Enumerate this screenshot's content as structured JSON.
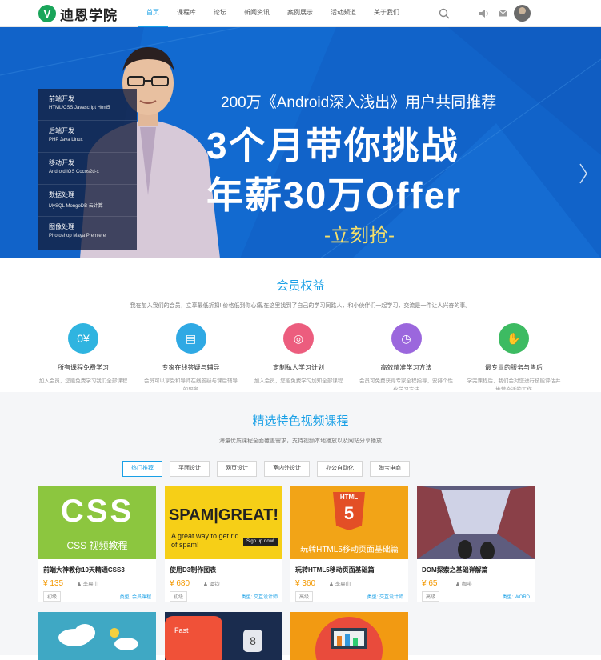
{
  "header": {
    "logo_text": "迪恩学院",
    "logo_glyph": "V",
    "nav": [
      "首页",
      "课程库",
      "论坛",
      "新闻资讯",
      "案例展示",
      "活动频道",
      "关于我们"
    ],
    "icons": [
      "search-icon",
      "volume-icon",
      "mail-icon",
      "avatar"
    ]
  },
  "banner": {
    "subtitle": "200万《Android深入浅出》用户共同推荐",
    "headline1": "3个月带你挑战",
    "headline2": "年薪30万Offer",
    "cta": "-立刻抢-",
    "menu": [
      {
        "title": "前端开发",
        "sub": "HTML/CSS    Javascript    Html5"
      },
      {
        "title": "后端开发",
        "sub": "PHP    Java    Linux"
      },
      {
        "title": "移动开发",
        "sub": "Android    iOS    Cocos2d-x"
      },
      {
        "title": "数据处理",
        "sub": "MySQL    MongoDB    云计算"
      },
      {
        "title": "图像处理",
        "sub": "Photoshop    Maya    Premiere"
      }
    ]
  },
  "benefits": {
    "title": "会员权益",
    "desc": "我在加入我们的会员，立享最低折扣! 价格低到你心痛,在这里找到了自己的学习同路人，和小伙伴们一起学习，交流是一件让人兴奋的事。",
    "items": [
      {
        "title": "所有课程免费学习",
        "desc": "加入会员，您能免费学习我们全部课程",
        "color": "#2fb4e0",
        "glyph": "0¥"
      },
      {
        "title": "专家在线答疑与辅导",
        "desc": "会员可以享受和导师在线答疑与课后辅导的服务",
        "color": "#2fa9e4",
        "glyph": "▤"
      },
      {
        "title": "定制私人学习计划",
        "desc": "加入会员，您能免费学习加知全部课程",
        "color": "#ec5d7e",
        "glyph": "◎"
      },
      {
        "title": "高效精准学习方法",
        "desc": "会员可免费获得专家全程指导，安排个性化学习方法",
        "color": "#9b67dd",
        "glyph": "◷"
      },
      {
        "title": "最专业的服务与售后",
        "desc": "学完课程后，我们会对您进行技能评估并推荐合适的工作",
        "color": "#3dbb62",
        "glyph": "✋"
      }
    ]
  },
  "courses": {
    "title": "精选特色视频课程",
    "desc": "海量优质课程全面覆盖需求，支持视频本地播放以及网站分享播放",
    "tabs": [
      "热门推荐",
      "平面设计",
      "网页设计",
      "室内外设计",
      "办公自动化",
      "淘宝电商"
    ],
    "level_label": "初级",
    "items": [
      {
        "title": "前端大神教你10天精通CSS3",
        "price": "¥ 135",
        "teacher": "李晨山",
        "level": "初级",
        "type": "类型: 会员课程",
        "thumb_text1": "CSS",
        "thumb_text2": "CSS 视频教程"
      },
      {
        "title": "使用D3制作图表",
        "price": "¥ 680",
        "teacher": "谭钧",
        "level": "初级",
        "type": "类型: 交互设计师",
        "thumb_text1": "SPAM|GREAT!",
        "thumb_text2": "A great way to get rid of spam!",
        "thumb_text3": "Sign up now!"
      },
      {
        "title": "玩转HTML5移动页面基础篇",
        "price": "¥ 360",
        "teacher": "李晨山",
        "level": "高级",
        "type": "类型: 交互设计师",
        "thumb_text1": "HTML",
        "thumb_text2": "玩转HTML5移动页面基础篇"
      },
      {
        "title": "DOM探索之基础详解篇",
        "price": "¥ 65",
        "teacher": "咖啡",
        "level": "高级",
        "type": "类型: WORD",
        "thumb_text1": "",
        "thumb_text2": ""
      }
    ],
    "row2_text": [
      "Fast",
      "8"
    ]
  }
}
